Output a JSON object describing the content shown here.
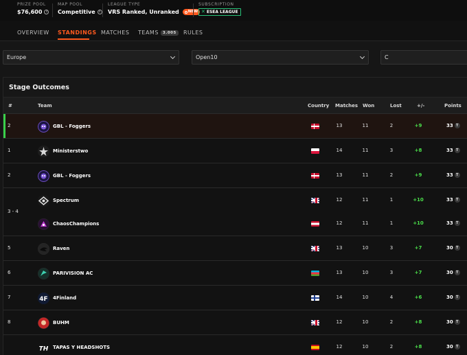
{
  "header": {
    "prize_pool": {
      "label": "PRIZE POOL",
      "value": "$76,600"
    },
    "map_pool": {
      "label": "MAP POOL",
      "value": "Competitive"
    },
    "league_type": {
      "label": "LEAGUE TYPE",
      "value": "VRS Ranked, Unranked",
      "badge": "NEW"
    },
    "subscription": {
      "label": "SUBSCRIPTION",
      "value": "ESEA LEAGUE"
    }
  },
  "tabs": [
    {
      "label": "OVERVIEW",
      "active": false
    },
    {
      "label": "STANDINGS",
      "active": true
    },
    {
      "label": "MATCHES",
      "active": false
    },
    {
      "label": "TEAMS",
      "active": false,
      "count": "3.005"
    },
    {
      "label": "RULES",
      "active": false
    }
  ],
  "filters": {
    "region": "Europe",
    "division": "Open10",
    "conference": "C"
  },
  "panel": {
    "title": "Stage Outcomes"
  },
  "columns": {
    "rank": "#",
    "team": "Team",
    "country": "Country",
    "matches": "Matches",
    "won": "Won",
    "lost": "Lost",
    "diff": "+/-",
    "points": "Points"
  },
  "points_icon": "T",
  "rows": [
    {
      "rank": "2",
      "team": "GBL - Foggers",
      "flag": "dk",
      "logo": "foggers",
      "matches": "13",
      "won": "11",
      "lost": "2",
      "diff": "+9",
      "points": "33",
      "highlight": true
    },
    {
      "rank": "1",
      "team": "Ministerstwo",
      "flag": "pl",
      "logo": "ministerstwo",
      "matches": "14",
      "won": "11",
      "lost": "3",
      "diff": "+8",
      "points": "33"
    },
    {
      "rank": "2",
      "team": "GBL - Foggers",
      "flag": "dk",
      "logo": "foggers",
      "matches": "13",
      "won": "11",
      "lost": "2",
      "diff": "+9",
      "points": "33"
    },
    {
      "rank": "3 - 4",
      "team": "Spectrum",
      "flag": "gb",
      "logo": "spectrum",
      "matches": "12",
      "won": "11",
      "lost": "1",
      "diff": "+10",
      "points": "33"
    },
    {
      "rank": "",
      "team": "ChaosChampions",
      "flag": "at",
      "logo": "chaos",
      "matches": "12",
      "won": "11",
      "lost": "1",
      "diff": "+10",
      "points": "33"
    },
    {
      "rank": "5",
      "team": "Raven",
      "flag": "gb",
      "logo": "raven",
      "matches": "13",
      "won": "10",
      "lost": "3",
      "diff": "+7",
      "points": "30"
    },
    {
      "rank": "6",
      "team": "PARIVISION AC",
      "flag": "az",
      "logo": "parivision",
      "matches": "13",
      "won": "10",
      "lost": "3",
      "diff": "+7",
      "points": "30"
    },
    {
      "rank": "7",
      "team": "4Finland",
      "flag": "fi",
      "logo": "4finland",
      "matches": "14",
      "won": "10",
      "lost": "4",
      "diff": "+6",
      "points": "30"
    },
    {
      "rank": "8",
      "team": "BUHM",
      "flag": "gb",
      "logo": "buhm",
      "matches": "12",
      "won": "10",
      "lost": "2",
      "diff": "+8",
      "points": "30"
    },
    {
      "rank": "",
      "team": "TAPAS Y HEADSHOTS",
      "flag": "es",
      "logo": "tapas",
      "matches": "12",
      "won": "10",
      "lost": "2",
      "diff": "+8",
      "points": "30"
    }
  ],
  "colors": {
    "accent": "#ff5a1f",
    "positive": "#4be04b",
    "qualified": "#3ad14a",
    "esea": "#29c47a"
  }
}
